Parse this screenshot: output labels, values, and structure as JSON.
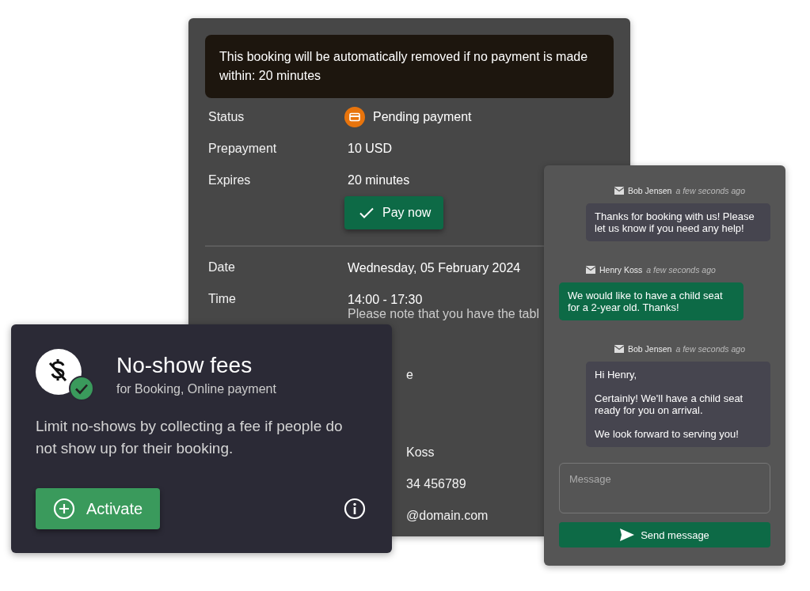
{
  "booking": {
    "notice": "This booking will be automatically removed if no payment is made within: 20 minutes",
    "details": [
      {
        "label": "Status",
        "value": "Pending payment",
        "kind": "status"
      },
      {
        "label": "Prepayment",
        "value": "10 USD",
        "kind": "plain"
      },
      {
        "label": "Expires",
        "value": "20 minutes",
        "kind": "plain"
      }
    ],
    "pay_button": "Pay now",
    "schedule": [
      {
        "label": "Date",
        "value": "Wednesday, 05 February 2024"
      },
      {
        "label": "Time",
        "value": "14:00 - 17:30",
        "note": "Please note that you have the tabl"
      }
    ],
    "covered_values": [
      "e",
      "Koss",
      "34 456789",
      "@domain.com"
    ]
  },
  "addon": {
    "title": "No-show fees",
    "subtitle": "for Booking, Online payment",
    "description": "Limit no-shows by collecting a fee if people do not show up for their booking.",
    "activate_button": "Activate"
  },
  "chat": {
    "messages": [
      {
        "author": "Bob Jensen",
        "time": "a few seconds ago",
        "text": "Thanks for booking with us! Please let us know if you need any help!",
        "kind": "staff"
      },
      {
        "author": "Henry Koss",
        "time": "a few seconds ago",
        "text": "We would like to have a child seat for a 2-year old. Thanks!",
        "kind": "guest"
      },
      {
        "author": "Bob Jensen",
        "time": "a few seconds ago",
        "text": "Hi Henry,\n\nCertainly! We'll have a child seat ready for you on arrival.\n\nWe look forward to serving you!",
        "kind": "staff"
      }
    ],
    "message_placeholder": "Message",
    "send_button": "Send message"
  }
}
